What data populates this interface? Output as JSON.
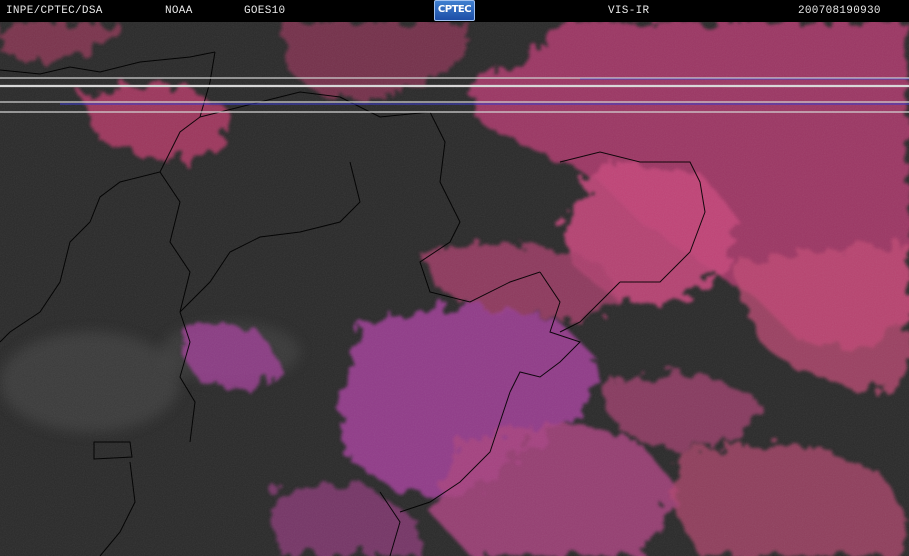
{
  "header": {
    "institution": "INPE/CPTEC/DSA",
    "agency": "NOAA",
    "satellite": "GOES10",
    "logo_text": "CPTEC",
    "channel": "VIS-IR",
    "timestamp": "200708190930"
  },
  "colors": {
    "background": "#2a2a2a",
    "cloud_magenta": "#b2397a",
    "cloud_pink": "#d8486e",
    "cloud_violet": "#8a3d8f",
    "border_lines": "#000000",
    "scan_line": "#d0d0d0",
    "scan_line_blue": "#3c3cc8"
  },
  "icons": {
    "logo": "cptec-logo"
  }
}
